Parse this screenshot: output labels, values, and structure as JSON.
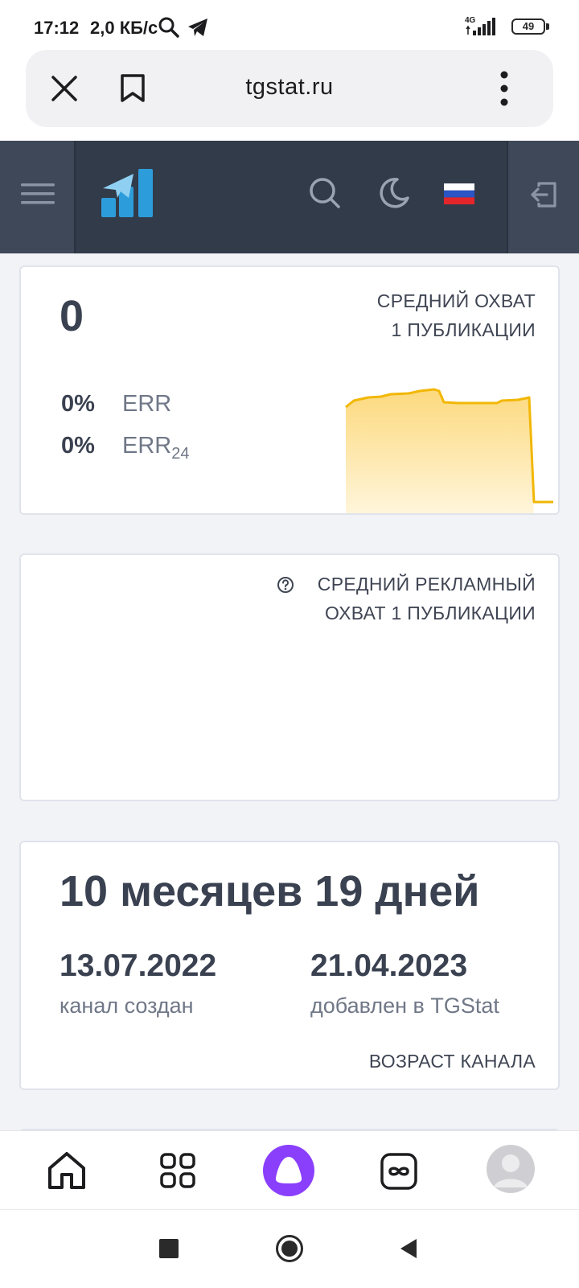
{
  "status_bar": {
    "time": "17:12",
    "speed": "2,0 КБ/с",
    "network": "4G",
    "battery": "49"
  },
  "browser": {
    "url": "tgstat.ru"
  },
  "reach_card": {
    "value": "0",
    "label_line1": "СРЕДНИЙ ОХВАТ",
    "label_line2": "1 ПУБЛИКАЦИИ",
    "err_value": "0%",
    "err_label": "ERR",
    "err24_value": "0%",
    "err24_label": "ERR",
    "err24_sub": "24"
  },
  "ad_reach_card": {
    "label_line1": "СРЕДНИЙ РЕКЛАМНЫЙ",
    "label_line2": "ОХВАТ 1 ПУБЛИКАЦИИ"
  },
  "age_card": {
    "age": "10 месяцев 19 дней",
    "created_date": "13.07.2022",
    "created_label": "канал создан",
    "added_date": "21.04.2023",
    "added_label": "добавлен в TGStat",
    "footer_label": "ВОЗРАСТ КАНАЛА"
  },
  "colors": {
    "header_bg": "#323b4a",
    "accent_chart": "#f2b705",
    "logo_blue": "#2d9cdb",
    "assistant_purple": "#8a3ffc"
  }
}
